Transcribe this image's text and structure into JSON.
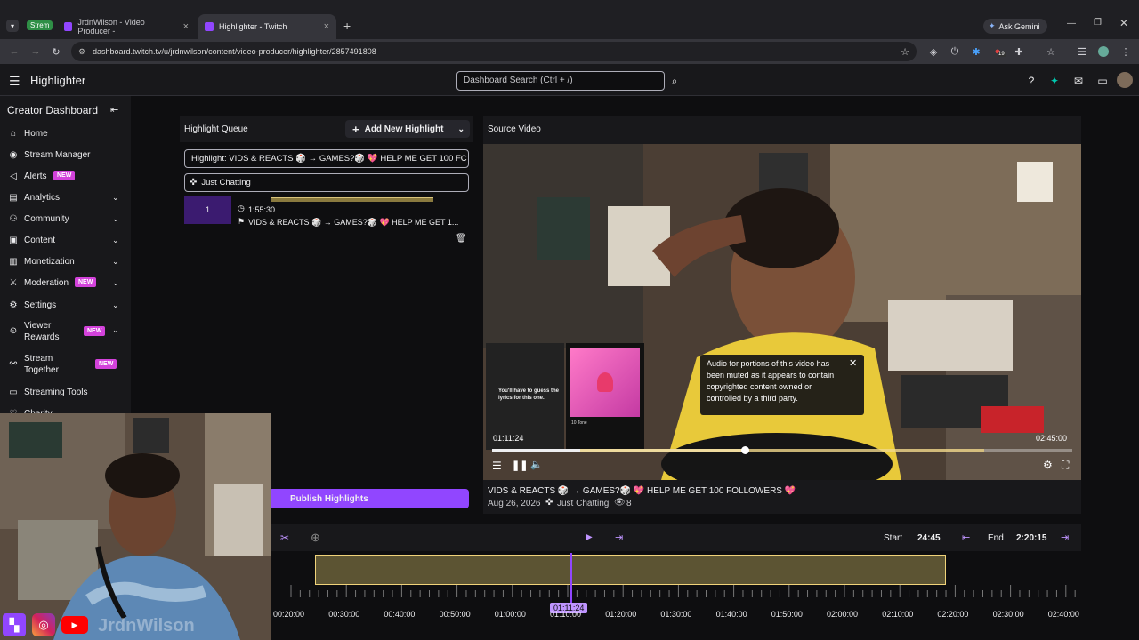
{
  "browser": {
    "profile_badge": "Strem",
    "tabs": [
      {
        "title": "JrdnWilson - Video Producer -"
      },
      {
        "title": "Highlighter - Twitch"
      }
    ],
    "url": "dashboard.twitch.tv/u/jrdnwilson/content/video-producer/highlighter/2857491808",
    "ask_gemini": "Ask Gemini",
    "ext_badge": "19"
  },
  "topbar": {
    "title": "Highlighter",
    "search_placeholder": "Dashboard Search (Ctrl + /)"
  },
  "sidebar": {
    "heading": "Creator Dashboard",
    "items": [
      {
        "label": "Home",
        "icon": "home-icon"
      },
      {
        "label": "Stream Manager",
        "icon": "broadcast-icon"
      },
      {
        "label": "Alerts",
        "icon": "megaphone-icon",
        "badge": "NEW"
      },
      {
        "label": "Analytics",
        "icon": "analytics-icon"
      },
      {
        "label": "Community",
        "icon": "community-icon"
      },
      {
        "label": "Content",
        "icon": "content-icon"
      },
      {
        "label": "Monetization",
        "icon": "monetization-icon"
      },
      {
        "label": "Moderation",
        "icon": "sword-icon",
        "badge": "NEW"
      },
      {
        "label": "Settings",
        "icon": "gear-icon"
      },
      {
        "label_line1": "Viewer",
        "label_line2": "Rewards",
        "icon": "rewards-icon",
        "badge": "NEW"
      },
      {
        "label_line1": "Stream",
        "label_line2": "Together",
        "icon": "together-icon",
        "badge": "NEW"
      },
      {
        "label": "Streaming Tools",
        "icon": "tools-icon"
      },
      {
        "label": "Charity",
        "icon": "charity-icon"
      }
    ]
  },
  "queue": {
    "title": "Highlight Queue",
    "add_button": "Add New Highlight",
    "title_field_value": "Highlight: VIDS & REACTS 🎲 → GAMES?🎲 💖 HELP ME GET 100 FC",
    "category_value": "Just Chatting",
    "item": {
      "index": "1",
      "duration": "1:55:30",
      "title": "VIDS & REACTS 🎲 → GAMES?🎲 💖 HELP ME GET 1..."
    },
    "publish_button": "Publish Highlights"
  },
  "source": {
    "title": "Source Video",
    "mute_notice": "Audio for portions of this video has been muted as it appears to contain copyrighted content owned or controlled by a third party.",
    "current_time": "01:11:24",
    "end_time": "02:45:00",
    "progress": 0.435,
    "thumb_caption": "You'll have to guess the lyrics for this one.",
    "thumb_card": "10 Tone",
    "video_title": "VIDS & REACTS 🎲 → GAMES?🎲 💖 HELP ME GET 100 FOLLOWERS 💖",
    "date": "Aug 26, 2026",
    "category": "Just Chatting",
    "views": "8"
  },
  "timeline": {
    "start_label": "Start",
    "start_value": "24:45",
    "end_label": "End",
    "end_value": "2:20:15",
    "playhead": "01:11:24",
    "ticks": [
      "00:20:00",
      "00:30:00",
      "00:40:00",
      "00:50:00",
      "01:00:00",
      "01:10:00",
      "01:20:00",
      "01:30:00",
      "01:40:00",
      "01:50:00",
      "02:00:00",
      "02:10:00",
      "02:20:00",
      "02:30:00",
      "02:40:00"
    ]
  },
  "webcam": {
    "overlay_text": "JrdnWilson"
  },
  "colors": {
    "accent": "#9146ff",
    "new_badge": "#d342db",
    "clip_fill": "#5c5433",
    "clip_border": "#f0d37a"
  }
}
